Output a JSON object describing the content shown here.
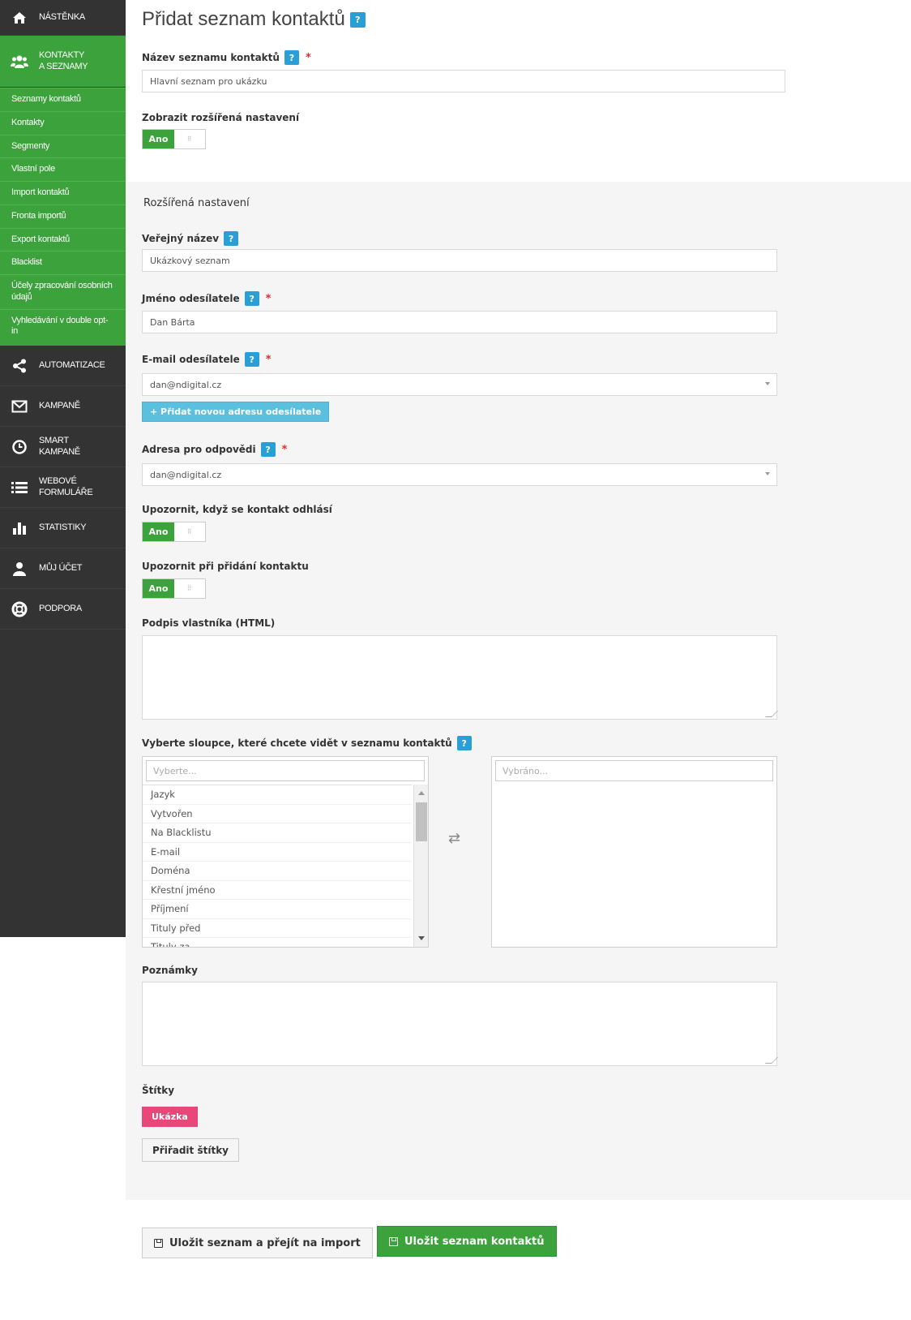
{
  "sidebar": {
    "items": [
      {
        "label": "NÁSTĚNKA",
        "icon": "home-icon"
      },
      {
        "label1": "KONTAKTY",
        "label2": "A SEZNAMY",
        "icon": "users-icon"
      },
      {
        "label": "AUTOMATIZACE",
        "icon": "share-icon"
      },
      {
        "label": "KAMPANĚ",
        "icon": "envelope-icon"
      },
      {
        "label1": "SMART",
        "label2": "KAMPANĚ",
        "icon": "clock-icon"
      },
      {
        "label1": "WEBOVÉ",
        "label2": "FORMULÁŘE",
        "icon": "list-icon"
      },
      {
        "label": "STATISTIKY",
        "icon": "bar-chart-icon"
      },
      {
        "label": "MŮJ ÚČET",
        "icon": "user-icon"
      },
      {
        "label": "PODPORA",
        "icon": "lifebuoy-icon"
      }
    ],
    "subitems": [
      "Seznamy kontaktů",
      "Kontakty",
      "Segmenty",
      "Vlastní pole",
      "Import kontaktů",
      "Fronta importů",
      "Export kontaktů",
      "Blacklist",
      "Účely zpracování osobních údajů",
      "Vyhledávání v double opt-in"
    ]
  },
  "page": {
    "title": "Přidat seznam kontaktů",
    "help": "?"
  },
  "form": {
    "list_name_label": "Název seznamu kontaktů",
    "list_name_value": "Hlavní seznam pro ukázku",
    "show_advanced_label": "Zobrazit rozšířená nastavení",
    "toggle_yes": "Ano",
    "advanced_title": "Rozšířená nastavení",
    "public_name_label": "Veřejný název",
    "public_name_value": "Ukázkový seznam",
    "sender_name_label": "Jméno odesílatele",
    "sender_name_value": "Dan Bárta",
    "sender_email_label": "E-mail odesílatele",
    "sender_email_value": "dan@ndigital.cz",
    "add_sender_button": "+ Přidat novou adresu odesílatele",
    "reply_to_label": "Adresa pro odpovědi",
    "reply_to_value": "dan@ndigital.cz",
    "notify_unsub_label": "Upozornit, když se kontakt odhlásí",
    "notify_add_label": "Upozornit při přidání kontaktu",
    "signature_label": "Podpis vlastníka (HTML)",
    "columns_label": "Vyberte sloupce, které chcete vidět v seznamu kontaktů",
    "available_placeholder": "Vyberte...",
    "selected_placeholder": "Vybráno...",
    "available_columns": [
      "Jazyk",
      "Vytvořen",
      "Na Blacklistu",
      "E-mail",
      "Doména",
      "Křestní jméno",
      "Příjmení",
      "Tituly před",
      "Tituly za"
    ],
    "notes_label": "Poznámky",
    "tags_label": "Štítky",
    "tag_value": "Ukázka",
    "assign_tags_button": "Přiřadit štítky",
    "save_import_button": "Uložit seznam a přejít na import",
    "save_button": "Uložit seznam kontaktů",
    "required_mark": "*"
  },
  "colors": {
    "sidebar_bg": "#333333",
    "accent_green": "#3ca33c",
    "help_blue": "#2a9fd6",
    "tag_pink": "#e9467a",
    "info_button": "#5bc0de"
  }
}
